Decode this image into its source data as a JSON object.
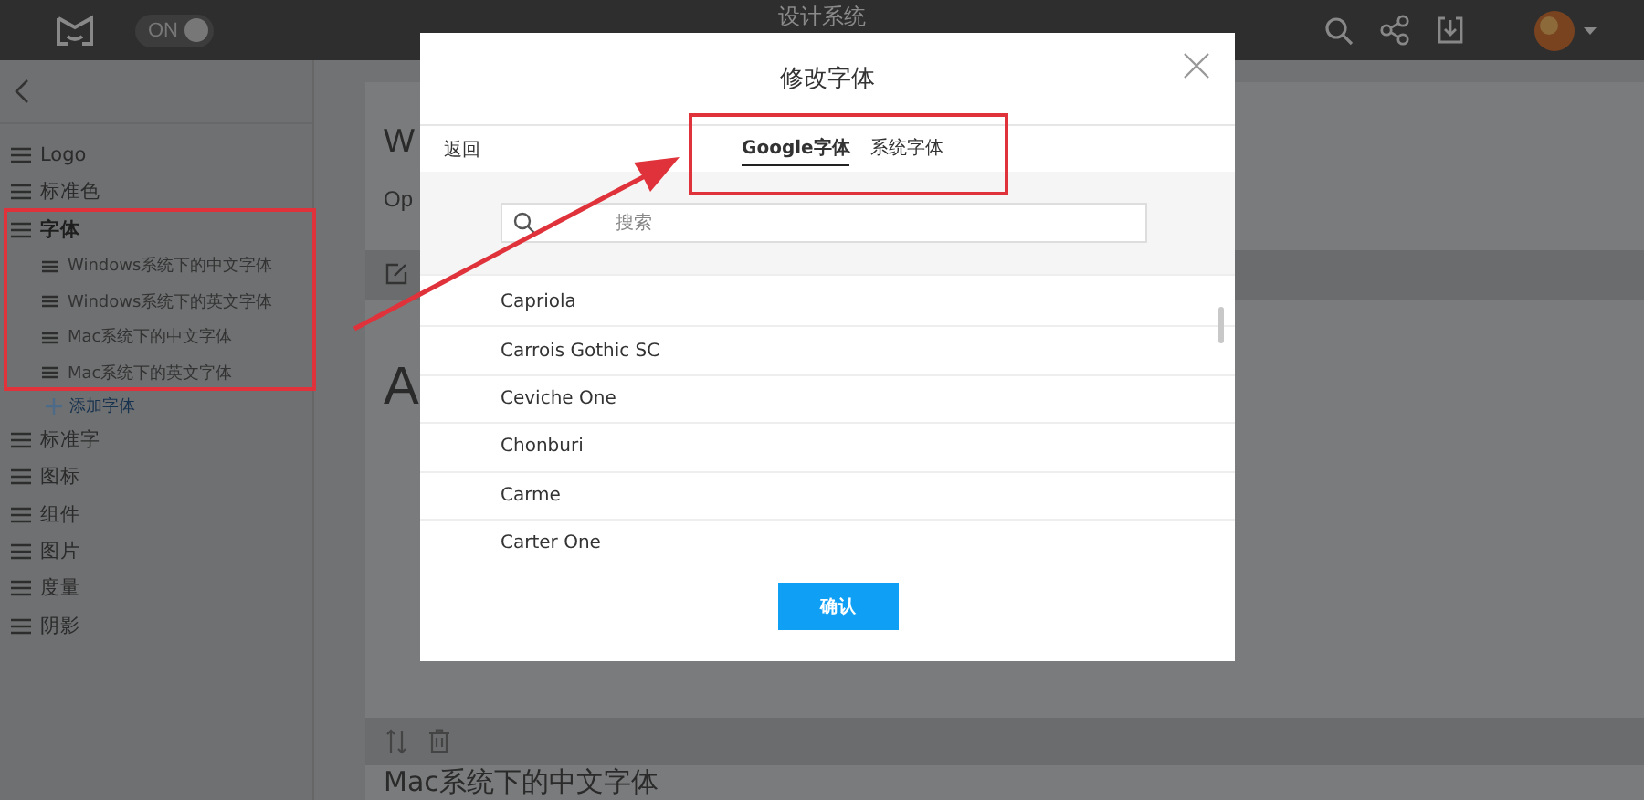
{
  "header": {
    "toggle": {
      "label": "ON",
      "on": true
    },
    "title": "设计系统"
  },
  "sidebar": {
    "items": [
      {
        "label": "Logo",
        "selected": false
      },
      {
        "label": "标准色",
        "selected": false
      },
      {
        "label": "字体",
        "selected": true,
        "children": [
          {
            "label": "Windows系统下的中文字体",
            "selected": false
          },
          {
            "label": "Windows系统下的英文字体",
            "selected": false
          },
          {
            "label": "Mac系统下的中文字体",
            "selected": false
          },
          {
            "label": "Mac系统下的英文字体",
            "selected": false
          }
        ],
        "add_label": "添加字体"
      },
      {
        "label": "标准字",
        "selected": false
      },
      {
        "label": "图标",
        "selected": false
      },
      {
        "label": "组件",
        "selected": false
      },
      {
        "label": "图片",
        "selected": false
      },
      {
        "label": "度量",
        "selected": false
      },
      {
        "label": "阴影",
        "selected": false
      }
    ]
  },
  "main": {
    "heading": "W",
    "subheading": "Op",
    "sample": "A",
    "next_heading": "Mac系统下的中文字体"
  },
  "dialog": {
    "title": "修改字体",
    "back": "返回",
    "tabs": [
      {
        "label": "Google字体",
        "selected": true
      },
      {
        "label": "系统字体",
        "selected": false
      }
    ],
    "search": {
      "placeholder": "搜索"
    },
    "fonts": [
      "Capriola",
      "Carrois Gothic SC",
      "Ceviche One",
      "Chonburi",
      "Carme",
      "Carter One"
    ],
    "confirm": "确认"
  }
}
